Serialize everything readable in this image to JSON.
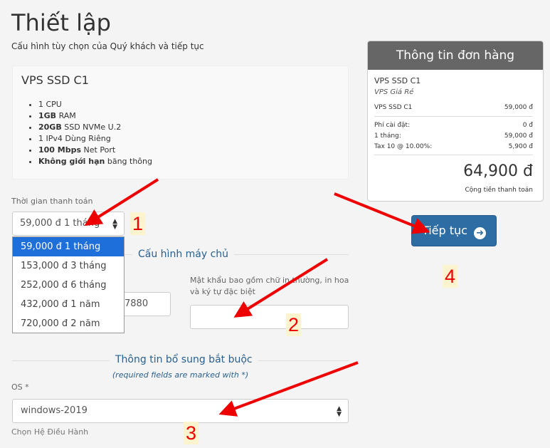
{
  "page": {
    "title": "Thiết lập",
    "subtitle": "Cấu hình tùy chọn của Quý khách và tiếp tục"
  },
  "product": {
    "name": "VPS SSD C1",
    "features": [
      {
        "bold": "",
        "text": "1 CPU"
      },
      {
        "bold": "1GB",
        "text": " RAM"
      },
      {
        "bold": "20GB",
        "text": " SSD NVMe U.2"
      },
      {
        "bold": "",
        "text": "1 IPv4 Dùng Riêng"
      },
      {
        "bold": "100 Mbps",
        "text": " Net Port"
      },
      {
        "bold": "Không giới hạn",
        "text": " băng thông"
      }
    ]
  },
  "billing": {
    "label": "Thời gian thanh toán",
    "selected": "59,000 đ 1 tháng",
    "options": [
      "59,000 đ 1 tháng",
      "153,000 đ 3 tháng",
      "252,000 đ 6 tháng",
      "432,000 đ 1 năm",
      "720,000 đ 2 năm"
    ]
  },
  "server_config": {
    "title": "Cấu hình máy chủ",
    "partial_value": "7880",
    "password_label": "Mật khẩu bao gồm chữ in thường, in hoa và ký tự đặc biệt",
    "password_value": ""
  },
  "extra": {
    "title": "Thông tin bổ sung bắt buộc",
    "note": "(required fields are marked with *)",
    "os_label": "OS *",
    "os_value": "windows-2019",
    "os_help": "Chọn Hệ Điều Hành"
  },
  "summary": {
    "title": "Thông tin đơn hàng",
    "product": "VPS SSD C1",
    "group": "VPS Giá Rẻ",
    "line_label": "VPS SSD C1",
    "line_value": "59,000 đ",
    "setup_label": "Phí cài đặt:",
    "setup_value": "0 đ",
    "period_label": "1 tháng:",
    "period_value": "59,000 đ",
    "tax_label": "Tax 10 @ 10.00%:",
    "tax_value": "5,900 đ",
    "total": "64,900 đ",
    "total_label": "Cộng tiền thanh toán"
  },
  "continue_button": {
    "label": "Tiếp tục",
    "icon": "arrow-circle-right-icon"
  },
  "annotations": [
    "1",
    "2",
    "3",
    "4"
  ],
  "colors": {
    "accent": "#2e6da4",
    "annotation": "#e00000",
    "summary_header": "#666666",
    "dropdown_active": "#1e6fd9"
  }
}
